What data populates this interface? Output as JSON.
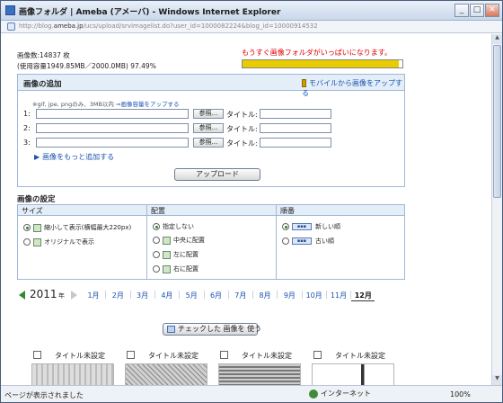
{
  "window": {
    "title": "画像フォルダ | Ameba (アメーバ) - Windows Internet Explorer",
    "minimize": "_",
    "maximize": "□",
    "close": "✕"
  },
  "address": {
    "prefix": "http://blog.",
    "domain": "ameba.jp",
    "rest": "/ucs/upload/srvimagelist.do?user_id=1000082224&blog_id=10000914532"
  },
  "info": {
    "image_count": "画像数:14837 枚",
    "usage": "(使用容量1949.85MB／2000.0MB) 97.49%",
    "warning": "もうすぐ画像フォルダがいっぱいになります。",
    "usage_fraction": 0.9749
  },
  "add_section": {
    "title": "画像の追加",
    "mobile_link": "モバイルから画像をアップする",
    "formats_note": "※gif, jpe, pngのみ、3MB以内",
    "formats_link": "⇒画像容量をアップする",
    "browse_label": "参照...",
    "title_label": "タイトル:",
    "rows": [
      {
        "num": "1:"
      },
      {
        "num": "2:"
      },
      {
        "num": "3:"
      }
    ],
    "more_link": "画像をもっと追加する",
    "upload_button": "アップロード"
  },
  "settings": {
    "title": "画像の設定",
    "size": {
      "header": "サイズ",
      "options": [
        "縮小して表示(横幅最大220px)",
        "オリジナルで表示"
      ],
      "selected": 0
    },
    "align": {
      "header": "配置",
      "options": [
        "指定しない",
        "中央に配置",
        "左に配置",
        "右に配置"
      ],
      "selected": 0
    },
    "order": {
      "header": "順番",
      "options": [
        "新しい順",
        "古い順"
      ],
      "selected": 0
    }
  },
  "months": {
    "year": "2011",
    "year_suffix": "年",
    "items": [
      "1月",
      "2月",
      "3月",
      "4月",
      "5月",
      "6月",
      "7月",
      "8月",
      "9月",
      "10月",
      "11月",
      "12月"
    ],
    "active": "12月"
  },
  "use_checked_button": "チェックした 画像を 使う",
  "images": [
    {
      "title": "タイトル未設定"
    },
    {
      "title": "タイトル未設定"
    },
    {
      "title": "タイトル未設定"
    },
    {
      "title": "タイトル未設定"
    }
  ],
  "status": {
    "text": "ページが表示されました",
    "zone": "インターネット",
    "zoom": "100%"
  }
}
